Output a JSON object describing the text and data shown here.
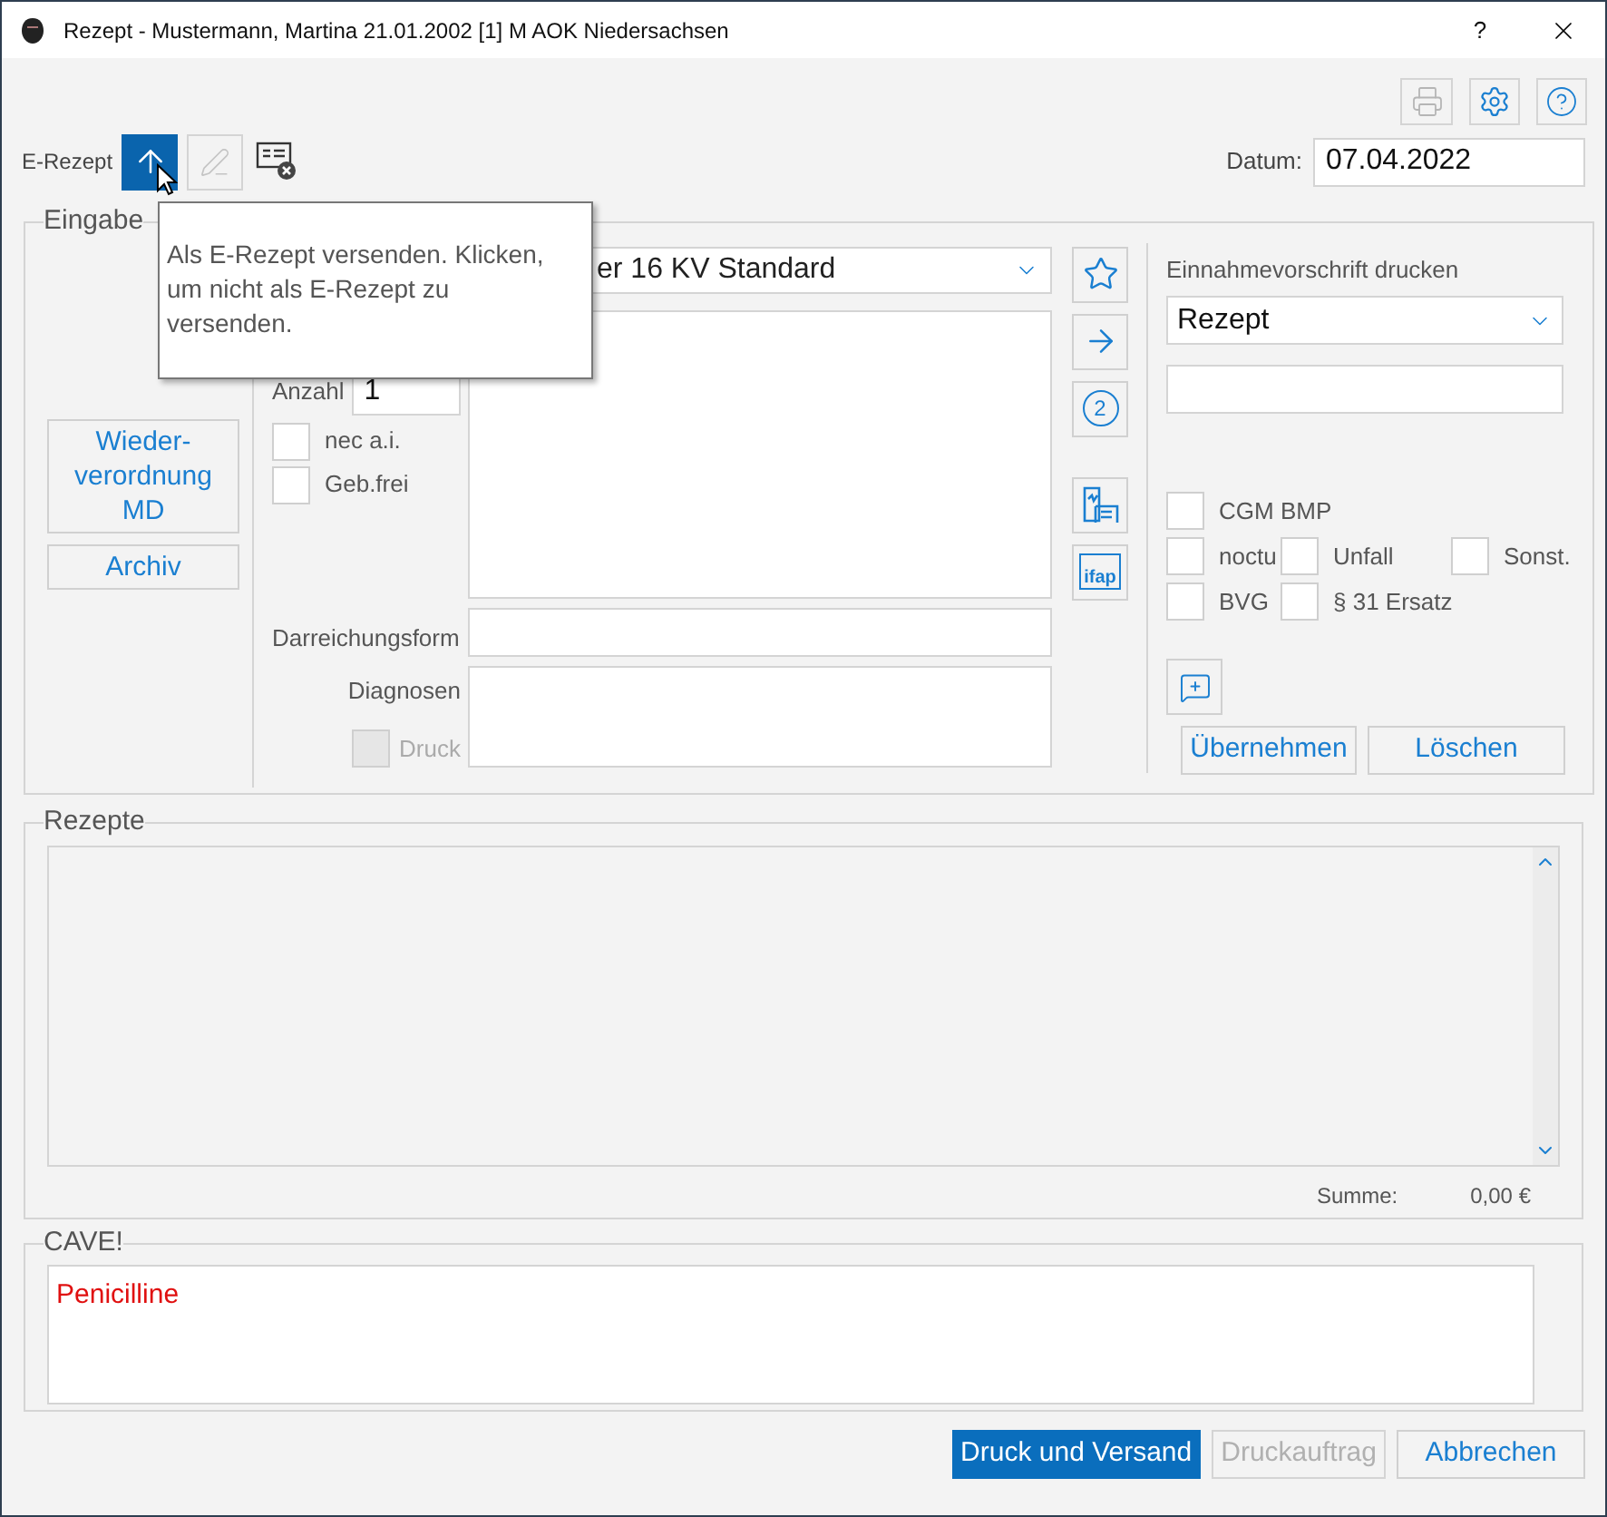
{
  "window": {
    "title": "Rezept - Mustermann, Martina 21.01.2002 [1] M AOK Niedersachsen",
    "help": "?"
  },
  "erezept": {
    "label": "E-Rezept",
    "send_selected": true,
    "sign_disabled": true
  },
  "date": {
    "label": "Datum:",
    "value": "07.04.2022"
  },
  "tooltip": "Als E-Rezept versenden. Klicken, um nicht als E-Rezept zu versenden.",
  "eingabe": {
    "title": "Eingabe",
    "side_buttons": [
      "Wieder-\nverordnung\nMD",
      "Archiv"
    ],
    "template": "er 16 KV Standard",
    "anzahl": {
      "label": "Anzahl",
      "value": "1"
    },
    "checkboxes": [
      {
        "label": "nec a.i.",
        "checked": false
      },
      {
        "label": "Geb.frei",
        "checked": false
      }
    ],
    "darreichungsform": {
      "label": "Darreichungsform"
    },
    "diagnosen": {
      "label": "Diagnosen"
    },
    "druck": {
      "label": "Druck",
      "checked": false,
      "disabled": true
    },
    "tool_buttons": [
      {
        "kind": "star"
      },
      {
        "kind": "arrow"
      },
      {
        "kind": "number",
        "text": "2"
      },
      {
        "kind": "chart"
      },
      {
        "kind": "logo",
        "text": "ifap"
      }
    ],
    "einnahme": {
      "label": "Einnahmevorschrift drucken",
      "value": "Rezept"
    },
    "flag_rows": [
      [
        {
          "label": "CGM BMP",
          "checked": false
        }
      ],
      [
        {
          "label": "noctu",
          "checked": false
        },
        {
          "label": "Unfall",
          "checked": false
        },
        {
          "label": "Sonst.",
          "checked": false
        }
      ],
      [
        {
          "label": "BVG",
          "checked": false
        },
        {
          "label": "§ 31 Ersatz",
          "checked": false
        }
      ]
    ],
    "actions": [
      "Übernehmen",
      "Löschen"
    ]
  },
  "rezepte": {
    "title": "Rezepte",
    "sum_label": "Summe:",
    "sum_value": "0,00 €"
  },
  "cave": {
    "title": "CAVE!",
    "text": "Penicilline"
  },
  "footer_buttons": [
    {
      "label": "Druck und Versand",
      "kind": "primary"
    },
    {
      "label": "Druckauftrag",
      "kind": "disabled"
    },
    {
      "label": "Abbrechen",
      "kind": "default"
    }
  ]
}
